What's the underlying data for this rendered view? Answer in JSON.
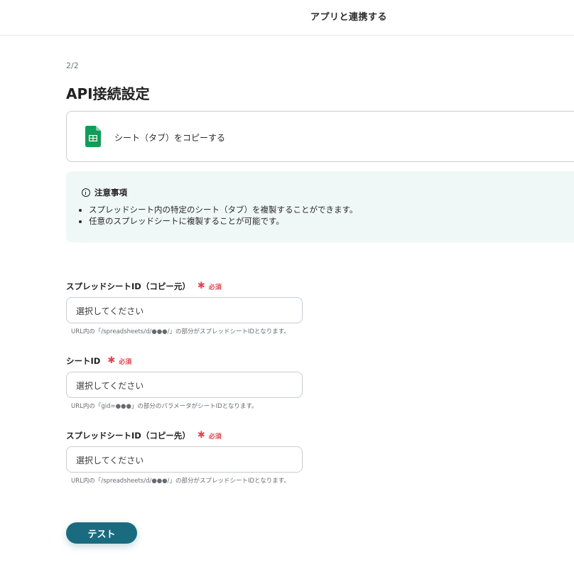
{
  "header": {
    "title": "アプリと連携する"
  },
  "step": "2/2",
  "page_title": "API接続設定",
  "action": {
    "icon": "google-sheets-icon",
    "label": "シート（タブ）をコピーする"
  },
  "notice": {
    "title": "注意事項",
    "items": [
      "スプレッドシート内の特定のシート（タブ）を複製することができます。",
      "任意のスプレッドシートに複製することが可能です。"
    ]
  },
  "fields": [
    {
      "label": "スプレッドシートID（コピー元）",
      "required_label": "必須",
      "placeholder": "選択してください",
      "hint": "URL内の「/spreadsheets/d/●●●/」の部分がスプレッドシートIDとなります。"
    },
    {
      "label": "シートID",
      "required_label": "必須",
      "placeholder": "選択してください",
      "hint": "URL内の「gid=●●●」の部分のパラメータがシートIDとなります。"
    },
    {
      "label": "スプレッドシートID（コピー先）",
      "required_label": "必須",
      "placeholder": "選択してください",
      "hint": "URL内の「/spreadsheets/d/●●●/」の部分がスプレッドシートIDとなります。"
    }
  ],
  "test_button": "テスト",
  "colors": {
    "primary": "#1a6b80",
    "required": "#e0464f",
    "notice_bg": "#f0f7f7",
    "sheets_green": "#0f9d58"
  }
}
